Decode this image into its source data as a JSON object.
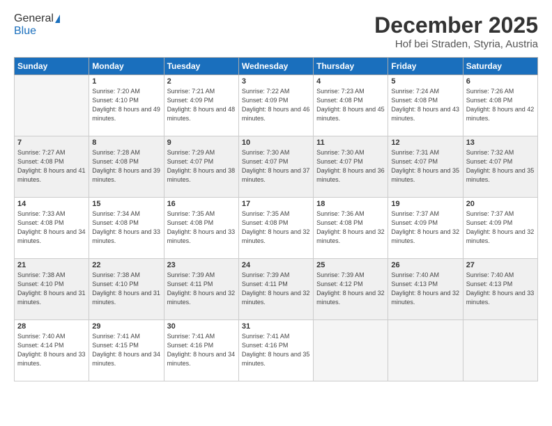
{
  "logo": {
    "general": "General",
    "blue": "Blue"
  },
  "header": {
    "title": "December 2025",
    "subtitle": "Hof bei Straden, Styria, Austria"
  },
  "weekdays": [
    "Sunday",
    "Monday",
    "Tuesday",
    "Wednesday",
    "Thursday",
    "Friday",
    "Saturday"
  ],
  "weeks": [
    [
      {
        "day": "",
        "sunrise": "",
        "sunset": "",
        "daylight": "",
        "empty": true
      },
      {
        "day": "1",
        "sunrise": "7:20 AM",
        "sunset": "4:10 PM",
        "daylight": "8 hours and 49 minutes."
      },
      {
        "day": "2",
        "sunrise": "7:21 AM",
        "sunset": "4:09 PM",
        "daylight": "8 hours and 48 minutes."
      },
      {
        "day": "3",
        "sunrise": "7:22 AM",
        "sunset": "4:09 PM",
        "daylight": "8 hours and 46 minutes."
      },
      {
        "day": "4",
        "sunrise": "7:23 AM",
        "sunset": "4:08 PM",
        "daylight": "8 hours and 45 minutes."
      },
      {
        "day": "5",
        "sunrise": "7:24 AM",
        "sunset": "4:08 PM",
        "daylight": "8 hours and 43 minutes."
      },
      {
        "day": "6",
        "sunrise": "7:26 AM",
        "sunset": "4:08 PM",
        "daylight": "8 hours and 42 minutes."
      }
    ],
    [
      {
        "day": "7",
        "sunrise": "7:27 AM",
        "sunset": "4:08 PM",
        "daylight": "8 hours and 41 minutes."
      },
      {
        "day": "8",
        "sunrise": "7:28 AM",
        "sunset": "4:08 PM",
        "daylight": "8 hours and 39 minutes."
      },
      {
        "day": "9",
        "sunrise": "7:29 AM",
        "sunset": "4:07 PM",
        "daylight": "8 hours and 38 minutes."
      },
      {
        "day": "10",
        "sunrise": "7:30 AM",
        "sunset": "4:07 PM",
        "daylight": "8 hours and 37 minutes."
      },
      {
        "day": "11",
        "sunrise": "7:30 AM",
        "sunset": "4:07 PM",
        "daylight": "8 hours and 36 minutes."
      },
      {
        "day": "12",
        "sunrise": "7:31 AM",
        "sunset": "4:07 PM",
        "daylight": "8 hours and 35 minutes."
      },
      {
        "day": "13",
        "sunrise": "7:32 AM",
        "sunset": "4:07 PM",
        "daylight": "8 hours and 35 minutes."
      }
    ],
    [
      {
        "day": "14",
        "sunrise": "7:33 AM",
        "sunset": "4:08 PM",
        "daylight": "8 hours and 34 minutes."
      },
      {
        "day": "15",
        "sunrise": "7:34 AM",
        "sunset": "4:08 PM",
        "daylight": "8 hours and 33 minutes."
      },
      {
        "day": "16",
        "sunrise": "7:35 AM",
        "sunset": "4:08 PM",
        "daylight": "8 hours and 33 minutes."
      },
      {
        "day": "17",
        "sunrise": "7:35 AM",
        "sunset": "4:08 PM",
        "daylight": "8 hours and 32 minutes."
      },
      {
        "day": "18",
        "sunrise": "7:36 AM",
        "sunset": "4:08 PM",
        "daylight": "8 hours and 32 minutes."
      },
      {
        "day": "19",
        "sunrise": "7:37 AM",
        "sunset": "4:09 PM",
        "daylight": "8 hours and 32 minutes."
      },
      {
        "day": "20",
        "sunrise": "7:37 AM",
        "sunset": "4:09 PM",
        "daylight": "8 hours and 32 minutes."
      }
    ],
    [
      {
        "day": "21",
        "sunrise": "7:38 AM",
        "sunset": "4:10 PM",
        "daylight": "8 hours and 31 minutes."
      },
      {
        "day": "22",
        "sunrise": "7:38 AM",
        "sunset": "4:10 PM",
        "daylight": "8 hours and 31 minutes."
      },
      {
        "day": "23",
        "sunrise": "7:39 AM",
        "sunset": "4:11 PM",
        "daylight": "8 hours and 32 minutes."
      },
      {
        "day": "24",
        "sunrise": "7:39 AM",
        "sunset": "4:11 PM",
        "daylight": "8 hours and 32 minutes."
      },
      {
        "day": "25",
        "sunrise": "7:39 AM",
        "sunset": "4:12 PM",
        "daylight": "8 hours and 32 minutes."
      },
      {
        "day": "26",
        "sunrise": "7:40 AM",
        "sunset": "4:13 PM",
        "daylight": "8 hours and 32 minutes."
      },
      {
        "day": "27",
        "sunrise": "7:40 AM",
        "sunset": "4:13 PM",
        "daylight": "8 hours and 33 minutes."
      }
    ],
    [
      {
        "day": "28",
        "sunrise": "7:40 AM",
        "sunset": "4:14 PM",
        "daylight": "8 hours and 33 minutes."
      },
      {
        "day": "29",
        "sunrise": "7:41 AM",
        "sunset": "4:15 PM",
        "daylight": "8 hours and 34 minutes."
      },
      {
        "day": "30",
        "sunrise": "7:41 AM",
        "sunset": "4:16 PM",
        "daylight": "8 hours and 34 minutes."
      },
      {
        "day": "31",
        "sunrise": "7:41 AM",
        "sunset": "4:16 PM",
        "daylight": "8 hours and 35 minutes."
      },
      {
        "day": "",
        "sunrise": "",
        "sunset": "",
        "daylight": "",
        "empty": true
      },
      {
        "day": "",
        "sunrise": "",
        "sunset": "",
        "daylight": "",
        "empty": true
      },
      {
        "day": "",
        "sunrise": "",
        "sunset": "",
        "daylight": "",
        "empty": true
      }
    ]
  ]
}
